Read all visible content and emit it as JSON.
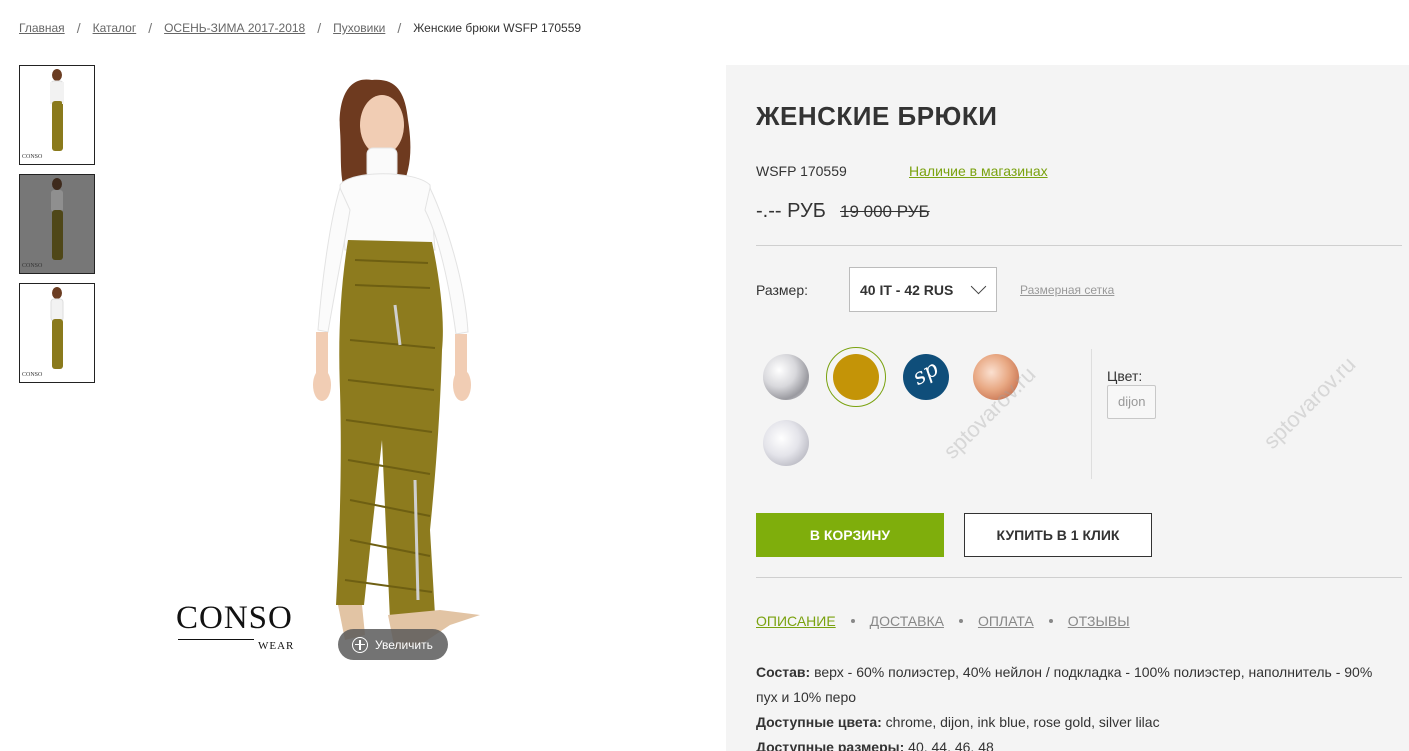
{
  "breadcrumb": {
    "items": [
      "Главная",
      "Каталог",
      "ОСЕНЬ-ЗИМА 2017-2018",
      "Пуховики"
    ],
    "separator": "/",
    "current": "Женские брюки WSFP 170559"
  },
  "gallery": {
    "thumbnails": [
      "front-view",
      "front-view-dimmed",
      "back-view"
    ],
    "brand_logo": "CONSO",
    "brand_sub": "WEAR",
    "zoom_label": "Увеличить",
    "zoom_icon": "plus-circle-icon"
  },
  "product": {
    "title": "ЖЕНСКИЕ БРЮКИ",
    "sku": "WSFP 170559",
    "stock_link": "Наличие в магазинах",
    "price": "-.-- РУБ",
    "old_price": "19 000 РУБ"
  },
  "size": {
    "label": "Размер:",
    "selected": "40 IT - 42 RUS",
    "chart_link": "Размерная сетка"
  },
  "colors": {
    "label": "Цвет:",
    "selected": "dijon",
    "swatches": [
      {
        "name": "chrome",
        "hex": "#c8c8cc"
      },
      {
        "name": "dijon",
        "hex": "#c49407",
        "selected": true
      },
      {
        "name": "ink blue",
        "hex": "#0f4e7a"
      },
      {
        "name": "rose gold",
        "hex": "#e8a883"
      },
      {
        "name": "silver lilac",
        "hex": "#dcdce2"
      }
    ]
  },
  "actions": {
    "add_to_cart": "В КОРЗИНУ",
    "buy_one_click": "КУПИТЬ В 1 КЛИК"
  },
  "tabs": [
    "ОПИСАНИЕ",
    "ДОСТАВКА",
    "ОПЛАТА",
    "ОТЗЫВЫ"
  ],
  "description": {
    "composition_label": "Состав:",
    "composition": "верх - 60% полиэстер, 40% нейлон / подкладка - 100% полиэстер, наполнитель - 90% пух и 10% перо",
    "colors_label": "Доступные цвета:",
    "colors": "chrome, dijon, ink blue, rose gold, silver lilac",
    "sizes_label": "Доступные размеры:",
    "sizes": "40, 44, 46, 48"
  },
  "watermark": "sptovarov.ru",
  "theme": {
    "accent_green": "#7fae0c",
    "link_green": "#7aa20f",
    "panel_bg": "#f4f4f4"
  }
}
